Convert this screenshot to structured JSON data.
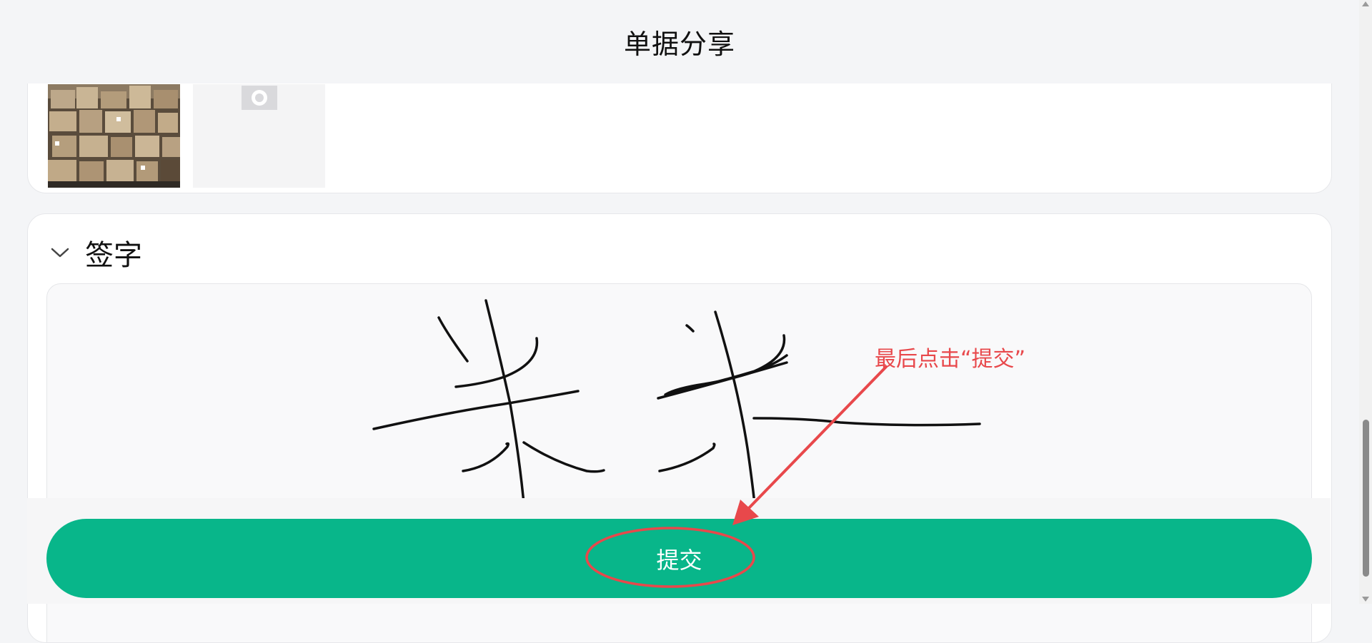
{
  "header": {
    "title": "单据分享"
  },
  "photos": {
    "thumbnail_icon": "cargo-photo",
    "placeholder_icon": "camera-icon"
  },
  "signature_section": {
    "title": "签字",
    "toggle_icon": "chevron-down-icon",
    "annotation_text": "最后点击“提交”"
  },
  "actions": {
    "submit_label": "提交"
  },
  "colors": {
    "primary": "#08b68a",
    "annotation": "#e8484b",
    "page_background": "#f4f5f7"
  }
}
